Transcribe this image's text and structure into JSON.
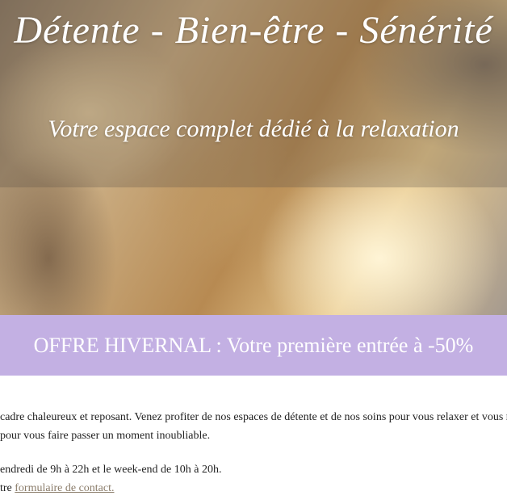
{
  "hero": {
    "title": "Détente - Bien-être - Sénérité",
    "subtitle": "Votre espace complet dédié à la relaxation"
  },
  "offer": {
    "text": "OFFRE HIVERNAL : Votre première entrée à -50%"
  },
  "content": {
    "line1": "cadre chaleureux et reposant. Venez profiter de nos espaces de détente et de nos soins pour vous relaxer et vous r",
    "line2": "pour vous faire passer un moment inoubliable.",
    "line3": "endredi de 9h à 22h et le week-end de 10h à 20h.",
    "line4_prefix": "tre ",
    "contact_link": "formulaire de contact."
  }
}
